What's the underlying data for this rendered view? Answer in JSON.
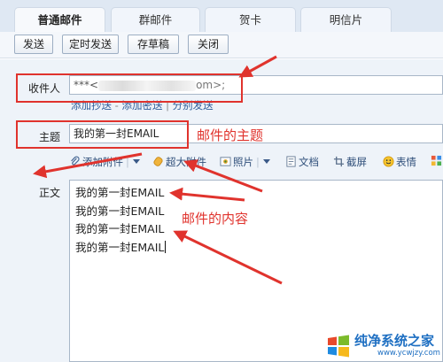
{
  "tabs": [
    {
      "label": "普通邮件",
      "active": true
    },
    {
      "label": "群邮件",
      "active": false
    },
    {
      "label": "贺卡",
      "active": false
    },
    {
      "label": "明信片",
      "active": false
    }
  ],
  "toolbar": {
    "send_label": "发送",
    "scheduled_send_label": "定时发送",
    "save_draft_label": "存草稿",
    "close_label": "关闭"
  },
  "recipient": {
    "label": "收件人",
    "value_prefix": "***<",
    "value_suffix": "om>;"
  },
  "recipient_links": {
    "add_cc": "添加抄送",
    "dash": "-",
    "add_bcc": "添加密送",
    "divider": "|",
    "separate_send": "分别发送"
  },
  "subject": {
    "label": "主题",
    "value": "我的第一封EMAIL"
  },
  "attach_toolbar": {
    "add_attachment": "添加附件",
    "large_attachment": "超大附件",
    "photo": "照片",
    "document": "文档",
    "screenshot": "截屏",
    "emoji": "表情"
  },
  "body": {
    "label": "正文",
    "lines": [
      "我的第一封EMAIL",
      "我的第一封EMAIL",
      "我的第一封EMAIL",
      "我的第一封EMAIL"
    ]
  },
  "annotations": {
    "subject_note": "邮件的主题",
    "content_note": "邮件的内容",
    "color": "#e0332d"
  },
  "watermark": {
    "brand": "纯净系统之家",
    "url": "www.ycwjzy.com"
  }
}
